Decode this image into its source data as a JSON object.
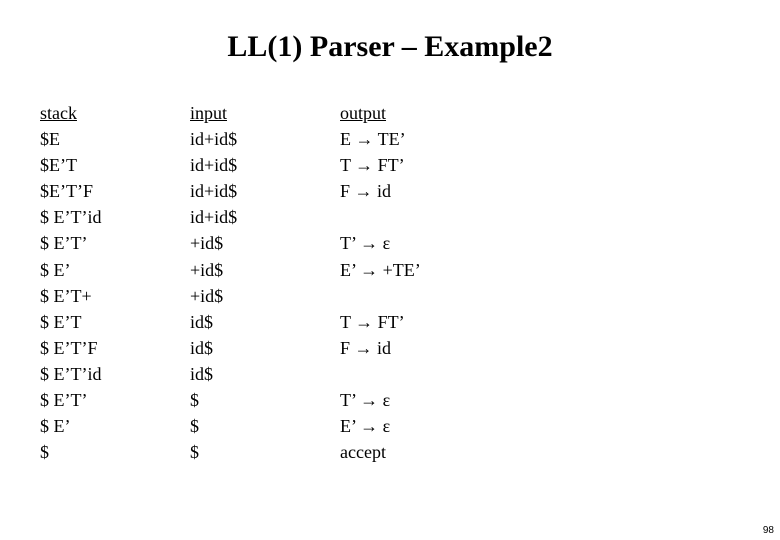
{
  "title": "LL(1) Parser – Example2",
  "headers": {
    "stack": "stack",
    "input": "input",
    "output": "output"
  },
  "rows": [
    {
      "stack": "$E",
      "input": "id+id$",
      "output": "E → TE’"
    },
    {
      "stack": "$E’T",
      "input": "id+id$",
      "output": "T → FT’"
    },
    {
      "stack": "$E’T’F",
      "input": "id+id$",
      "output": "F → id"
    },
    {
      "stack": "$ E’T’id",
      "input": "id+id$",
      "output": ""
    },
    {
      "stack": "$ E’T’",
      "input": "+id$",
      "output": "T’ → ε"
    },
    {
      "stack": "$ E’",
      "input": "+id$",
      "output": "E’ → +TE’"
    },
    {
      "stack": "$ E’T+",
      "input": "+id$",
      "output": ""
    },
    {
      "stack": "$ E’T",
      "input": "id$",
      "output": "T → FT’"
    },
    {
      "stack": "$ E’T’F",
      "input": "id$",
      "output": "F → id"
    },
    {
      "stack": "$ E’T’id",
      "input": "id$",
      "output": ""
    },
    {
      "stack": "$ E’T’",
      "input": "$",
      "output": "T’ → ε"
    },
    {
      "stack": "$ E’",
      "input": "$",
      "output": "E’ → ε"
    },
    {
      "stack": "$",
      "input": "$",
      "output": "accept"
    }
  ],
  "page_number": "98"
}
